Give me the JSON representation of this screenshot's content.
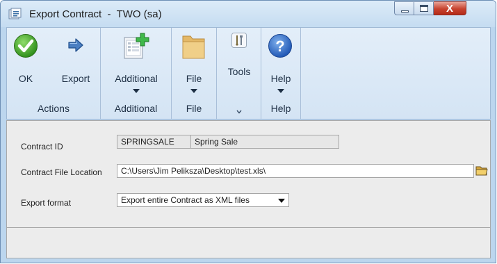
{
  "window": {
    "title": "Export Contract  -  TWO (sa)",
    "close_glyph": "X"
  },
  "ribbon": {
    "actions": {
      "ok_label": "OK",
      "export_label": "Export",
      "group_label": "Actions"
    },
    "additional": {
      "button_label": "Additional",
      "group_label": "Additional"
    },
    "file": {
      "button_label": "File",
      "group_label": "File"
    },
    "tools": {
      "button_label": "Tools"
    },
    "help": {
      "button_label": "Help",
      "group_label": "Help"
    }
  },
  "form": {
    "contract_id": {
      "label": "Contract ID",
      "id_value": "SPRINGSALE",
      "description": "Spring Sale"
    },
    "file_location": {
      "label": "Contract File Location",
      "value": "C:\\Users\\Jim Peliksza\\Desktop\\test.xls\\"
    },
    "export_format": {
      "label": "Export format",
      "selected": "Export entire Contract as XML files"
    }
  },
  "icons": [
    "app-icon",
    "ok-check-icon",
    "export-arrow-icon",
    "additional-page-plus-icon",
    "file-folder-icon",
    "tools-icon",
    "help-question-icon",
    "browse-folder-icon",
    "dropdown-arrow-icon"
  ]
}
